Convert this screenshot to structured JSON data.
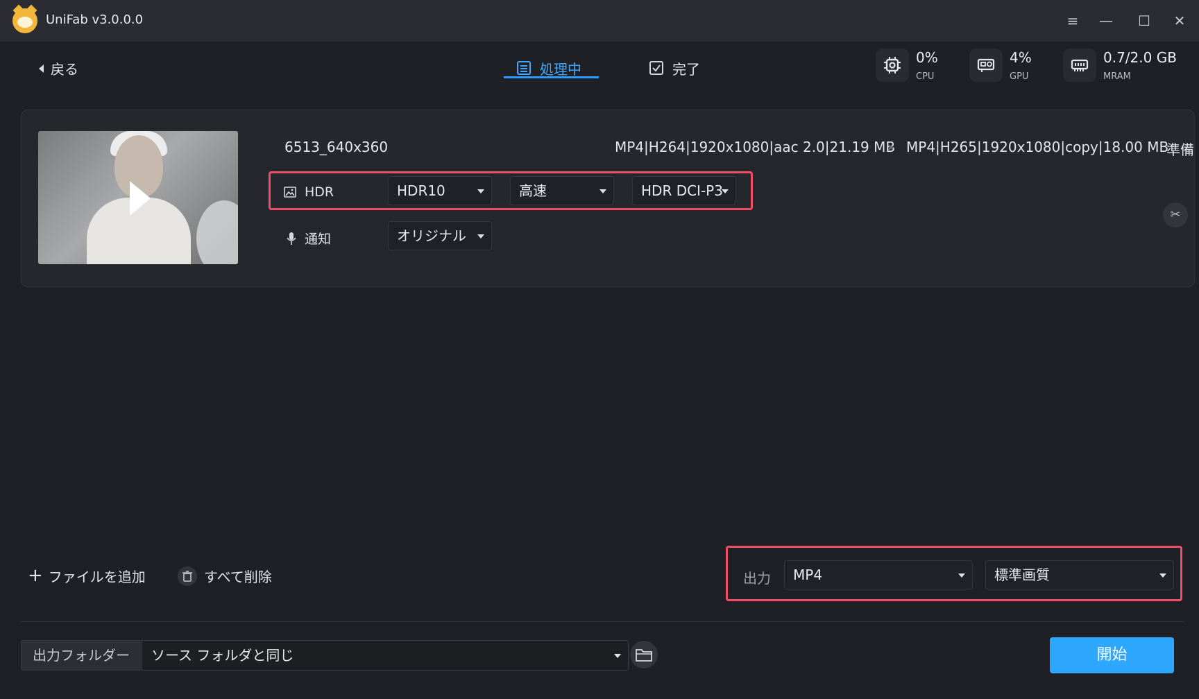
{
  "window": {
    "title": "UniFab v3.0.0.0",
    "controls": {
      "menu": "≡",
      "minimize": "—",
      "maximize": "☐",
      "close": "✕"
    }
  },
  "toolbar": {
    "back_label": "戻る",
    "tabs": [
      {
        "label": "処理中",
        "icon": "list-icon",
        "active": true
      },
      {
        "label": "完了",
        "icon": "checkbox-icon",
        "active": false
      }
    ]
  },
  "stats": [
    {
      "value": "0%",
      "label": "CPU",
      "icon": "cpu-icon"
    },
    {
      "value": "4%",
      "label": "GPU",
      "icon": "gpu-icon"
    },
    {
      "value": "0.7/2.0 GB",
      "label": "MRAM",
      "icon": "memory-icon"
    }
  ],
  "file": {
    "name": "6513_640x360",
    "source_info": "MP4|H264|1920x1080|aac 2.0|21.19 MB",
    "output_info": "MP4|H265|1920x1080|copy|18.00 MB",
    "status": "準備",
    "video_row": {
      "label": "HDR",
      "format": "HDR10",
      "speed": "高速",
      "color": "HDR DCI-P3"
    },
    "audio_row": {
      "label": "通知",
      "track": "オリジナル"
    }
  },
  "actions": {
    "add_file": "ファイルを追加",
    "delete_all": "すべて削除"
  },
  "output": {
    "label": "出力",
    "format": "MP4",
    "quality": "標準画質"
  },
  "folder": {
    "label": "出力フォルダー",
    "value": "ソース フォルダと同じ"
  },
  "start_label": "開始",
  "colors": {
    "accent": "#2ea8ff",
    "highlight": "#ef4e66",
    "background": "#1f2025"
  }
}
